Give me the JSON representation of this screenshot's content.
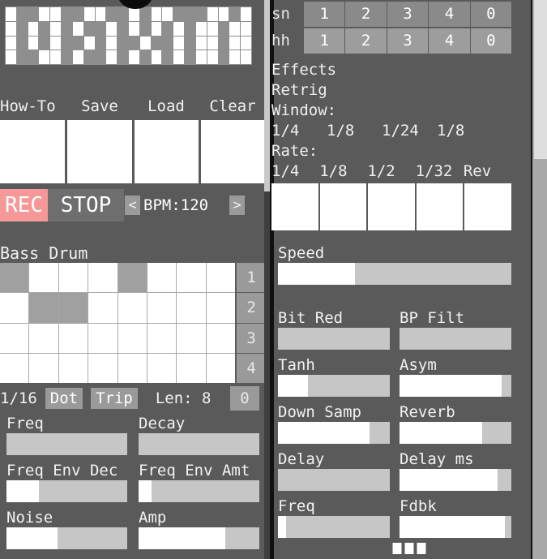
{
  "app": {
    "accent_rec": "#f79898",
    "panel_bg": "#5a5a5a",
    "cell_on": "#a0a0a0",
    "cell_off": "#ffffff"
  },
  "left": {
    "pixel_display": {
      "name": "pattern-pixel-display",
      "cols": 22,
      "rows": 4,
      "pattern": [
        [
          1,
          0,
          0,
          1,
          1,
          0,
          0,
          1,
          1,
          0,
          0,
          1,
          0,
          1,
          1,
          0,
          0,
          0,
          1,
          1,
          0,
          1
        ],
        [
          1,
          0,
          1,
          0,
          1,
          0,
          1,
          0,
          0,
          1,
          0,
          1,
          0,
          1,
          0,
          1,
          0,
          1,
          1,
          0,
          1,
          1
        ],
        [
          1,
          0,
          1,
          0,
          1,
          0,
          0,
          1,
          0,
          1,
          0,
          0,
          1,
          0,
          0,
          1,
          0,
          1,
          1,
          0,
          1,
          1
        ],
        [
          1,
          0,
          0,
          1,
          1,
          0,
          1,
          0,
          0,
          1,
          0,
          1,
          0,
          1,
          0,
          1,
          0,
          1,
          1,
          0,
          1,
          1
        ]
      ]
    },
    "menu": {
      "items": [
        {
          "label": "How-To",
          "name": "howto-button"
        },
        {
          "label": "Save",
          "name": "save-button"
        },
        {
          "label": "Load",
          "name": "load-button"
        },
        {
          "label": "Clear",
          "name": "clear-button"
        }
      ]
    },
    "slots": [
      "",
      "",
      "",
      ""
    ],
    "transport": {
      "rec_label": "REC",
      "stop_label": "STOP",
      "bpm_dec": "<",
      "bpm_label": "BPM:120",
      "bpm_value": 120,
      "bpm_inc": ">"
    },
    "instrument": {
      "title": "Bass Drum"
    },
    "sequencer": {
      "rows": 4,
      "cols": 8,
      "row_labels": [
        "1",
        "2",
        "3",
        "4"
      ],
      "steps": [
        [
          1,
          0,
          0,
          0,
          1,
          0,
          0,
          0
        ],
        [
          0,
          1,
          1,
          0,
          0,
          0,
          0,
          0
        ],
        [
          0,
          0,
          0,
          0,
          0,
          0,
          0,
          0
        ],
        [
          0,
          0,
          0,
          0,
          0,
          0,
          0,
          0
        ]
      ]
    },
    "divider_row": {
      "division": "1/16",
      "dot_label": "Dot",
      "trip_label": "Trip",
      "length_label": "Len: 8",
      "length_value": 8,
      "page_badge": "0"
    },
    "params": [
      {
        "label": "Freq",
        "name": "freq-slider",
        "fill_pct": 0
      },
      {
        "label": "Decay",
        "name": "decay-slider",
        "fill_pct": 0
      },
      {
        "label": "Freq Env Dec",
        "name": "freq-env-dec-slider",
        "fill_pct": 27
      },
      {
        "label": "Freq Env Amt",
        "name": "freq-env-amt-slider",
        "fill_pct": 11
      },
      {
        "label": "Noise",
        "name": "noise-slider",
        "fill_pct": 42
      },
      {
        "label": "Amp",
        "name": "amp-slider",
        "fill_pct": 72
      }
    ]
  },
  "right": {
    "kit_rows": [
      {
        "name": "sn",
        "steps": [
          "1",
          "2",
          "3",
          "4",
          "0"
        ],
        "selected": false
      },
      {
        "name": "hh",
        "steps": [
          "1",
          "2",
          "3",
          "4",
          "0"
        ],
        "selected": true
      }
    ],
    "effects": {
      "heading": "Effects",
      "retrig_label": "Retrig",
      "window_label": "Window:",
      "window_options": [
        "1/4",
        "1/8",
        "1/24",
        "1/8"
      ],
      "rate_label": "Rate:",
      "rate_options": [
        "1/4",
        "1/8",
        "1/2",
        "1/32",
        "Rev"
      ],
      "slots": [
        "",
        "",
        "",
        "",
        ""
      ]
    },
    "params": [
      {
        "label": "Speed",
        "name": "speed-slider",
        "fill_pct": 33
      },
      {
        "label": "Bit Red",
        "name": "bit-red-slider",
        "fill_pct": 0
      },
      {
        "label": "BP Filt",
        "name": "bp-filt-slider",
        "fill_pct": 0
      },
      {
        "label": "Tanh",
        "name": "tanh-slider",
        "fill_pct": 27
      },
      {
        "label": "Asym",
        "name": "asym-slider",
        "fill_pct": 91
      },
      {
        "label": "Down Samp",
        "name": "down-samp-slider",
        "fill_pct": 82
      },
      {
        "label": "Reverb",
        "name": "reverb-slider",
        "fill_pct": 74
      },
      {
        "label": "Delay",
        "name": "delay-slider",
        "fill_pct": 0
      },
      {
        "label": "Delay ms",
        "name": "delay-ms-slider",
        "fill_pct": 88
      },
      {
        "label": "Freq",
        "name": "fx-freq-slider",
        "fill_pct": 7
      },
      {
        "label": "Fdbk",
        "name": "fdbk-slider",
        "fill_pct": 94
      }
    ]
  },
  "pager": {
    "dots": 3
  }
}
